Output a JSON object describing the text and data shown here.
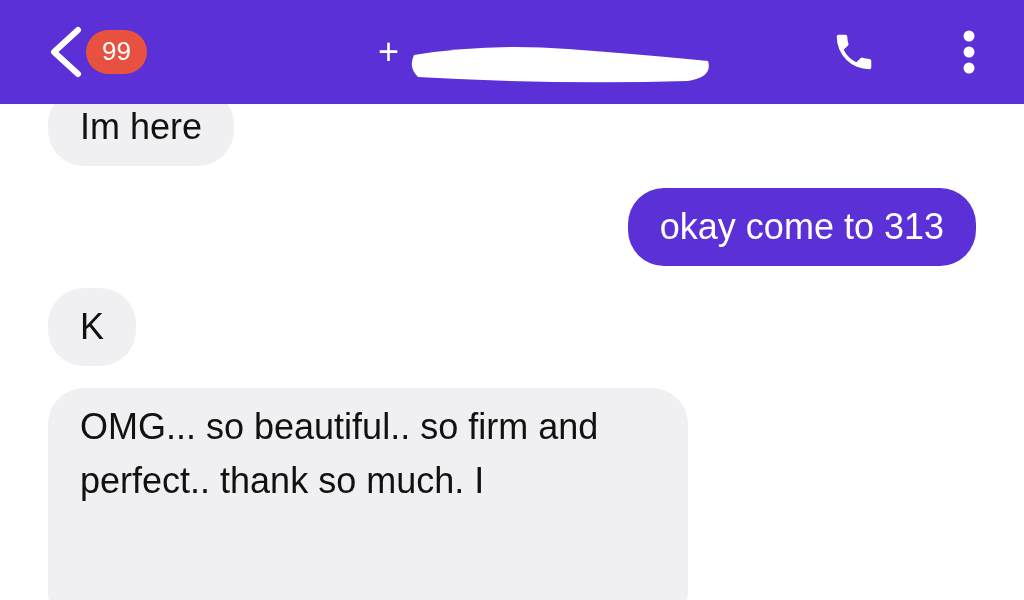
{
  "header": {
    "unread_count": "99",
    "title": "+"
  },
  "messages": [
    {
      "text": "Im here",
      "kind": "incoming"
    },
    {
      "text": "okay come to 313",
      "kind": "outgoing"
    },
    {
      "text": "K",
      "kind": "incoming"
    },
    {
      "text": "OMG... so beautiful.. so firm and perfect.. thank so much. I",
      "kind": "incoming"
    }
  ]
}
